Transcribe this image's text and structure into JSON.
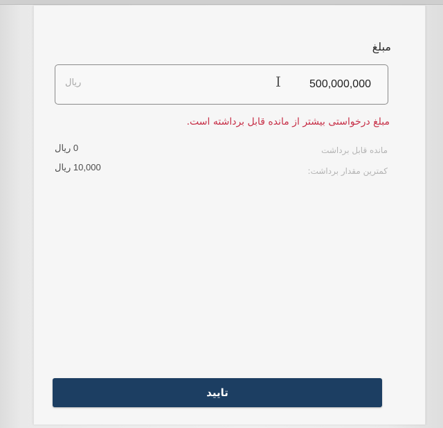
{
  "amount_field": {
    "label": "مبلغ",
    "value": "500,000,000",
    "currency_hint": "ریال"
  },
  "error_message": "مبلغ درخواستی بیشتر از مانده قابل برداشته است.",
  "info": {
    "remaining_label": "مانده قابل برداشت",
    "remaining_value": "0 ریال",
    "minimum_label": "کمترین مقدار برداشت:",
    "minimum_value": "10,000 ریال"
  },
  "confirm_button": {
    "label": "تایید",
    "color": "#1c3e62"
  },
  "colors": {
    "error": "#c72f47",
    "field_border": "#8a8a8a"
  },
  "icons": {
    "text_cursor": "i-beam-cursor-icon"
  }
}
